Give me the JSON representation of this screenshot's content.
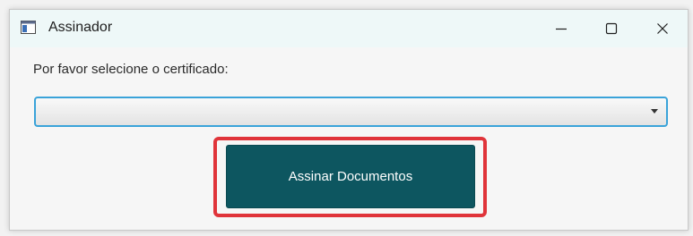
{
  "window": {
    "title": "Assinador",
    "controls": {
      "minimize": "minimize-icon",
      "maximize": "maximize-icon",
      "close": "close-icon"
    }
  },
  "form": {
    "prompt_label": "Por favor selecione o certificado:",
    "certificate_select_value": "",
    "submit_label": "Assinar Documentos"
  },
  "colors": {
    "titlebar_bg": "#eef8f8",
    "select_border": "#3aa3d9",
    "button_bg": "#0d5660",
    "highlight_border": "#e0343a"
  }
}
